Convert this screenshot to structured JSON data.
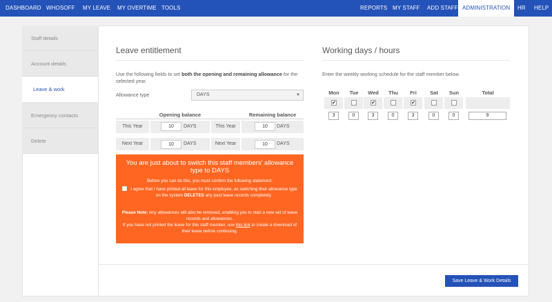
{
  "nav_left": [
    "DASHBOARD",
    "WHOSOFF",
    "MY LEAVE",
    "MY OVERTIME",
    "TOOLS"
  ],
  "nav_right": [
    "REPORTS",
    "MY STAFF",
    "ADD STAFF",
    "ADMINISTRATION",
    "HR",
    "HELP"
  ],
  "nav_active": "ADMINISTRATION",
  "side_tabs": [
    "Staff details",
    "Account details",
    "Leave & work",
    "Emergency contacts",
    "Delete"
  ],
  "side_active": "Leave & work",
  "leave": {
    "title": "Leave entitlement",
    "intro_pre": "Use the following fields to set ",
    "intro_bold": "both the opening and remaining allowance",
    "intro_post": " for the selected year.",
    "allowance_label": "Allowance type",
    "allowance_value": "DAYS",
    "opening_head": "Opening balance",
    "remaining_head": "Remaining balance",
    "rows": [
      {
        "label": "This Year",
        "opening": "10",
        "remaining": "10"
      },
      {
        "label": "Next Year",
        "opening": "10",
        "remaining": "10"
      }
    ],
    "unit": "DAYS"
  },
  "warning": {
    "title": "You are just about to switch this staff members' allowance type to DAYS",
    "confirm": "Before you can do this, you must confirm the following statement:",
    "agree_a": "I agree that I have printed all leave for this employee, as switching their allowance type on the system ",
    "agree_bold": "DELETES",
    "agree_b": " any past leave records completely.",
    "note_bold": "Please Note:",
    "note": " Any allowances will also be removed, enabling you to start a new set of leave records and allowances.",
    "link_pre": "If you have not printed the leave for this staff member, use ",
    "link_text": "this link",
    "link_post": " to create a download of their leave before continuing."
  },
  "working": {
    "title": "Working days / hours",
    "intro": "Enter the weekly working schedule for the staff member below.",
    "days": [
      {
        "name": "Mon",
        "checked": true,
        "hours": "3"
      },
      {
        "name": "Tue",
        "checked": false,
        "hours": "0"
      },
      {
        "name": "Wed",
        "checked": true,
        "hours": "3"
      },
      {
        "name": "Thu",
        "checked": false,
        "hours": "0"
      },
      {
        "name": "Fri",
        "checked": true,
        "hours": "3"
      },
      {
        "name": "Sat",
        "checked": false,
        "hours": "0"
      },
      {
        "name": "Sun",
        "checked": false,
        "hours": "0"
      }
    ],
    "total_label": "Total",
    "total_value": "9"
  },
  "save_label": "Save Leave & Work Details",
  "colors": {
    "brand": "#2352b8",
    "warning": "#ff6622"
  }
}
